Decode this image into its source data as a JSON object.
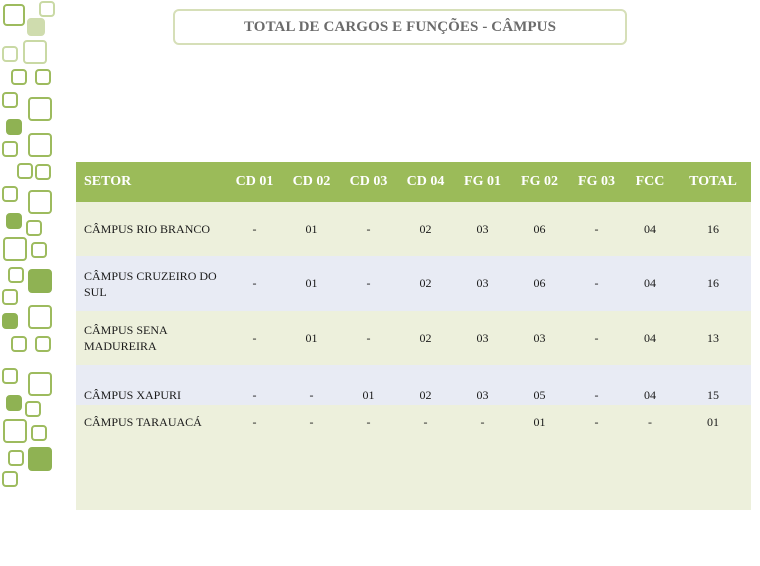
{
  "title": "TOTAL DE CARGOS E FUNÇÕES - CÂMPUS",
  "table": {
    "headers": [
      "SETOR",
      "CD 01",
      "CD 02",
      "CD 03",
      "CD 04",
      "FG 01",
      "FG 02",
      "FG 03",
      "FCC",
      "TOTAL"
    ],
    "rows": [
      [
        "CÂMPUS RIO BRANCO",
        "-",
        "01",
        "-",
        "02",
        "03",
        "06",
        "-",
        "04",
        "16"
      ],
      [
        "CÂMPUS CRUZEIRO DO SUL",
        "-",
        "01",
        "-",
        "02",
        "03",
        "06",
        "-",
        "04",
        "16"
      ],
      [
        "CÂMPUS SENA MADUREIRA",
        "-",
        "01",
        "-",
        "02",
        "03",
        "03",
        "-",
        "04",
        "13"
      ],
      [
        "CÂMPUS XAPURI",
        "-",
        "-",
        "01",
        "02",
        "03",
        "05",
        "-",
        "04",
        "15"
      ],
      [
        "CÂMPUS TARAUACÁ",
        "-",
        "-",
        "-",
        "-",
        "-",
        "01",
        "-",
        "-",
        "01"
      ]
    ]
  },
  "colors": {
    "header_bg": "#9bbb59",
    "row_green": "#edf0dc",
    "row_blue": "#e8ebf4",
    "decor_green": "#8fb253"
  }
}
